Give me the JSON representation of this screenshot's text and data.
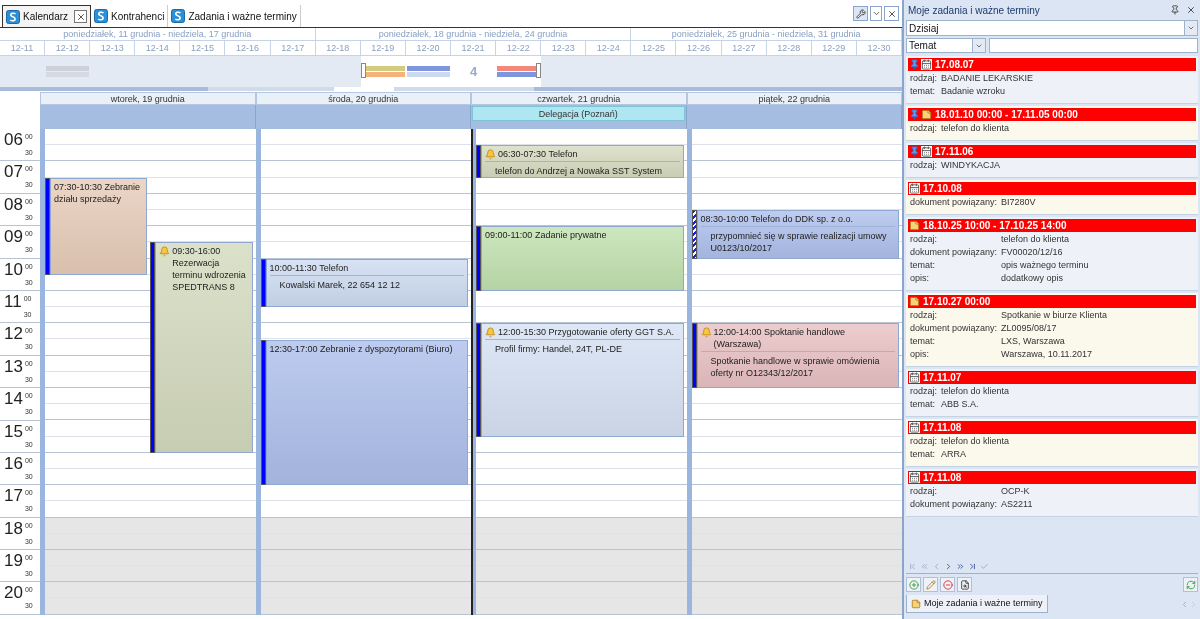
{
  "tabs": [
    {
      "label": "Kalendarz",
      "selected": true,
      "closable": true
    },
    {
      "label": "Kontrahenci",
      "selected": false,
      "closable": false
    },
    {
      "label": "Zadania i ważne terminy",
      "selected": false,
      "closable": false
    }
  ],
  "navigator": {
    "weeks": [
      "poniedziałek, 11 grudnia - niedziela, 17 grudnia",
      "poniedziałek, 18 grudnia - niedziela, 24 grudnia",
      "poniedziałek, 25 grudnia - niedziela, 31 grudnia"
    ],
    "days": [
      {
        "label": "12-11",
        "selected": false
      },
      {
        "label": "12-12",
        "selected": false,
        "bars": [
          {
            "color": "#ccd2dc"
          },
          {
            "color": "#d4d9e2"
          }
        ]
      },
      {
        "label": "12-13",
        "selected": false
      },
      {
        "label": "12-14",
        "selected": false
      },
      {
        "label": "12-15",
        "selected": false
      },
      {
        "label": "12-16",
        "selected": false
      },
      {
        "label": "12-17",
        "selected": false
      },
      {
        "label": "12-18",
        "selected": false
      },
      {
        "label": "12-19",
        "selected": true,
        "bars": [
          {
            "color": "#d3cb7d"
          },
          {
            "color": "#f5b27a"
          }
        ]
      },
      {
        "label": "12-20",
        "selected": true,
        "bars": [
          {
            "color": "#7f96de"
          },
          {
            "color": "#cdd9ee"
          }
        ]
      },
      {
        "label": "12-21",
        "selected": true,
        "count": "4"
      },
      {
        "label": "12-22",
        "selected": true,
        "bars": [
          {
            "color": "#f2877a"
          },
          {
            "color": "#7f96de"
          }
        ]
      },
      {
        "label": "12-23",
        "selected": false
      },
      {
        "label": "12-24",
        "selected": false
      },
      {
        "label": "12-25",
        "selected": false
      },
      {
        "label": "12-26",
        "selected": false
      },
      {
        "label": "12-27",
        "selected": false
      },
      {
        "label": "12-28",
        "selected": false
      },
      {
        "label": "12-29",
        "selected": false
      },
      {
        "label": "12-30",
        "selected": false
      }
    ]
  },
  "calendar": {
    "hours": [
      {
        "hour": "06",
        "minutes": [
          "00",
          "30"
        ],
        "working": true
      },
      {
        "hour": "07",
        "minutes": [
          "00",
          "30"
        ],
        "working": true
      },
      {
        "hour": "08",
        "minutes": [
          "00",
          "30"
        ],
        "working": true
      },
      {
        "hour": "09",
        "minutes": [
          "00",
          "30"
        ],
        "working": true
      },
      {
        "hour": "10",
        "minutes": [
          "00",
          "30"
        ],
        "working": true
      },
      {
        "hour": "11",
        "minutes": [
          "00",
          "30"
        ],
        "working": true
      },
      {
        "hour": "12",
        "minutes": [
          "00",
          "30"
        ],
        "working": true
      },
      {
        "hour": "13",
        "minutes": [
          "00",
          "30"
        ],
        "working": true
      },
      {
        "hour": "14",
        "minutes": [
          "00",
          "30"
        ],
        "working": true
      },
      {
        "hour": "15",
        "minutes": [
          "00",
          "30"
        ],
        "working": true
      },
      {
        "hour": "16",
        "minutes": [
          "00",
          "30"
        ],
        "working": true
      },
      {
        "hour": "17",
        "minutes": [
          "00",
          "30"
        ],
        "working": true
      },
      {
        "hour": "18",
        "minutes": [
          "00",
          "30"
        ],
        "working": false
      },
      {
        "hour": "19",
        "minutes": [
          "00",
          "30"
        ],
        "working": false
      },
      {
        "hour": "20",
        "minutes": [
          "00",
          "30"
        ],
        "working": false
      }
    ],
    "days": [
      {
        "label": "wtorek, 19 grudnia",
        "today": false,
        "events": [
          {
            "time": "07:30-10:30",
            "title": "Zebranie działu sprzedaży",
            "color": "#e6cbb8",
            "alarm": false,
            "kind": "busy"
          },
          {
            "time": "09:30-16:00",
            "title": "Rezerwacja terminu wdrozenia SPEDTRANS 8",
            "color": "#d3d9bd",
            "alarm": true,
            "kind": "busy"
          }
        ]
      },
      {
        "label": "środa, 20 grudnia",
        "today": false,
        "events": [
          {
            "time": "10:00-11:30",
            "title": "Telefon",
            "description": "Kowalski Marek, 22 654 12 12",
            "color": "#cddbf1",
            "alarm": false,
            "kind": "busy"
          },
          {
            "time": "12:30-17:00",
            "title": "Zebranie z dyspozytorami (Biuro)",
            "color": "#acbeea",
            "alarm": false,
            "kind": "busy"
          }
        ]
      },
      {
        "label": "czwartek, 21 grudnia",
        "today": true,
        "all_day": [
          "Delegacja (Poznań)"
        ],
        "events": [
          {
            "time": "06:30-07:30",
            "title": "Telefon",
            "description": "telefon do Andrzej a Nowaka SST System",
            "color": "#d6dabf",
            "alarm": true,
            "kind": "busy"
          },
          {
            "time": "09:00-11:00",
            "title": "Zadanie prywatne",
            "color": "#c0e0ae",
            "alarm": false,
            "kind": "busy"
          },
          {
            "time": "12:00-15:30",
            "title": "Przygotowanie oferty GGT S.A.",
            "description": "Profil firmy: Handel, 24T, PL-DE",
            "color": "#d6e1f3",
            "alarm": true,
            "kind": "busy"
          }
        ]
      },
      {
        "label": "piątek, 22 grudnia",
        "today": false,
        "events": [
          {
            "time": "08:30-10:00",
            "title": "Telefon do DDK sp. z o.o.",
            "description": "przypomnieć się w sprawie realizacji umowy U0123/10/2017",
            "color": "#adbfeb",
            "alarm": false,
            "kind": "tentative"
          },
          {
            "time": "12:00-14:00",
            "title": "Spoktanie handlowe (Warszawa)",
            "description": "Spotkanie handlowe w sprawie omówienia oferty nr O12343/12/2017",
            "color": "#e8c0c2",
            "alarm": true,
            "kind": "busy"
          }
        ]
      }
    ]
  },
  "panel": {
    "title": "Moje zadania i ważne terminy",
    "period": "Dzisiaj",
    "filter_field": "Temat",
    "items": [
      {
        "pinned": true,
        "kind": "calendar",
        "date": "17.08.07",
        "fields": [
          {
            "label": "rodzaj:",
            "value": "BADANIE LEKARSKIE"
          },
          {
            "label": "temat:",
            "value": "Badanie wzroku"
          }
        ]
      },
      {
        "pinned": true,
        "kind": "note",
        "date": "18.01.10 00:00 - 17.11.05 00:00",
        "fields": [
          {
            "label": "rodzaj:",
            "value": "telefon do klienta"
          }
        ]
      },
      {
        "pinned": true,
        "kind": "calendar",
        "date": "17.11.06",
        "fields": [
          {
            "label": "rodzaj:",
            "value": "WINDYKACJA"
          }
        ]
      },
      {
        "pinned": false,
        "kind": "calendar",
        "date": "17.10.08",
        "fields": [
          {
            "label": "dokument powiązany:",
            "value": "BI7280V"
          }
        ]
      },
      {
        "pinned": false,
        "kind": "note",
        "date": "18.10.25 10:00 - 17.10.25 14:00",
        "fields": [
          {
            "label": "rodzaj:",
            "value": "telefon do klienta"
          },
          {
            "label": "dokument powiązany:",
            "value": "FV00020/12/16"
          },
          {
            "label": "temat:",
            "value": "opis ważnego terminu"
          },
          {
            "label": "opis:",
            "value": "dodatkowy opis"
          }
        ]
      },
      {
        "pinned": false,
        "kind": "note",
        "date": "17.10.27 00:00",
        "fields": [
          {
            "label": "rodzaj:",
            "value": "Spotkanie w biurze Klienta"
          },
          {
            "label": "dokument powiązany:",
            "value": "ZL0095/08/17"
          },
          {
            "label": "temat:",
            "value": "LXS, Warszawa"
          },
          {
            "label": "opis:",
            "value": "Warszawa, 10.11.2017"
          }
        ]
      },
      {
        "pinned": false,
        "kind": "calendar",
        "date": "17.11.07",
        "fields": [
          {
            "label": "rodzaj:",
            "value": "telefon do klienta"
          },
          {
            "label": "temat:",
            "value": "ABB S.A."
          }
        ]
      },
      {
        "pinned": false,
        "kind": "calendar",
        "date": "17.11.08",
        "fields": [
          {
            "label": "rodzaj:",
            "value": "telefon do klienta"
          },
          {
            "label": "temat:",
            "value": "ARRA"
          }
        ]
      },
      {
        "pinned": false,
        "kind": "calendar",
        "date": "17.11.08",
        "fields": [
          {
            "label": "rodzaj:",
            "value": "OCP-K"
          },
          {
            "label": "dokument powiązany:",
            "value": "AS2211"
          }
        ]
      }
    ],
    "bottom_tab": "Moje zadania i ważne terminy"
  }
}
